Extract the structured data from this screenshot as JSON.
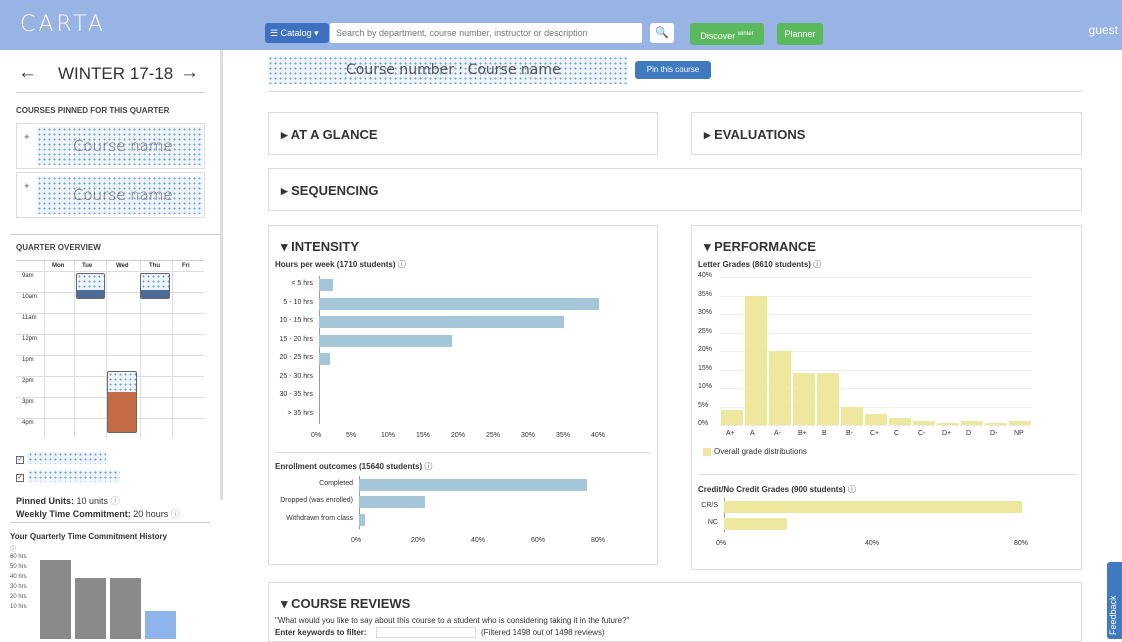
{
  "header": {
    "logo": "CARTA",
    "catalog_label": "☰ Catalog ▾",
    "search_placeholder": "Search by department, course number, instructor or description",
    "search_icon": "magnifier-icon",
    "discover_label": "Discover",
    "discover_sup": "winter",
    "planner_label": "Planner",
    "user": "guest"
  },
  "sidebar": {
    "quarter": "WINTER 17-18",
    "prev_arrow": "←",
    "next_arrow": "→",
    "pinned_title": "COURSES PINNED FOR THIS QUARTER",
    "pinned": [
      {
        "name": "Course name"
      },
      {
        "name": "Course name"
      }
    ],
    "overview_title": "QUARTER OVERVIEW",
    "days": [
      "Mon",
      "Tue",
      "Wed",
      "Thu",
      "Fri"
    ],
    "times": [
      "9am",
      "10am",
      "11am",
      "12pm",
      "1pm",
      "2pm",
      "3pm",
      "4pm"
    ],
    "pinned_units_label": "Pinned Units:",
    "pinned_units_value": "10 units",
    "weekly_label": "Weekly Time Commitment:",
    "weekly_value": "20 hours",
    "history_title": "Your Quarterly Time Commitment History",
    "history_axis": [
      "60 hrs",
      "50 hrs",
      "40 hrs",
      "30 hrs",
      "20 hrs",
      "10 hrs"
    ],
    "history_values": [
      57,
      44,
      44,
      20
    ],
    "history_colors": [
      "#8a8a8a",
      "#8a8a8a",
      "#8a8a8a",
      "#8fb4ec"
    ]
  },
  "course": {
    "banner": "Course number : Course name",
    "pin_button": "Pin this course"
  },
  "sections": {
    "glance": "▸ AT A GLANCE",
    "evaluations": "▸ EVALUATIONS",
    "sequencing": "▸ SEQUENCING",
    "intensity": "▾ INTENSITY",
    "performance": "▾ PERFORMANCE",
    "reviews": "▾ COURSE REVIEWS"
  },
  "reviews": {
    "question": "\"What would you like to say about this course to a student who is considering taking it in the future?\"",
    "filter_label": "Enter keywords to filter:",
    "filter_count": "(Filtered 1498 out of 1498 reviews)"
  },
  "feedback": "Feedback",
  "chart_data": [
    {
      "type": "bar",
      "orientation": "horizontal",
      "title": "Hours per week (1710 students)",
      "categories": [
        "< 5 hrs",
        "5 - 10 hrs",
        "10 - 15 hrs",
        "15 - 20 hrs",
        "20 - 25 hrs",
        "25 - 30 hrs",
        "30 - 35 hrs",
        "> 35 hrs"
      ],
      "values": [
        2,
        40,
        35,
        19,
        1.5,
        0,
        0,
        0
      ],
      "xticks": [
        "0%",
        "5%",
        "10%",
        "15%",
        "20%",
        "25%",
        "30%",
        "35%",
        "40%"
      ],
      "xlim": [
        0,
        40
      ]
    },
    {
      "type": "bar",
      "orientation": "horizontal",
      "title": "Enrollment outcomes (15640 students)",
      "categories": [
        "Completed",
        "Dropped (was enrolled)",
        "Withdrawn from class"
      ],
      "values": [
        76,
        22,
        2
      ],
      "xticks": [
        "0%",
        "20%",
        "40%",
        "60%",
        "80%"
      ],
      "xlim": [
        0,
        80
      ]
    },
    {
      "type": "bar",
      "title": "Letter Grades (8610 students)",
      "categories": [
        "A+",
        "A",
        "A-",
        "B+",
        "B",
        "B-",
        "C+",
        "C",
        "C-",
        "D+",
        "D",
        "D-",
        "NP"
      ],
      "values": [
        4,
        35,
        20,
        14,
        14,
        5,
        3,
        2,
        1,
        0.5,
        1,
        0.5,
        1
      ],
      "yticks": [
        "0%",
        "5%",
        "10%",
        "15%",
        "20%",
        "25%",
        "30%",
        "35%",
        "40%"
      ],
      "ylim": [
        0,
        40
      ],
      "legend": "Overall grade distributions"
    },
    {
      "type": "bar",
      "orientation": "horizontal",
      "title": "Credit/No Credit Grades (900 students)",
      "categories": [
        "CR/S",
        "NC"
      ],
      "values": [
        83,
        17
      ],
      "xticks": [
        "0%",
        "40%",
        "80%"
      ],
      "xlim": [
        0,
        80
      ]
    }
  ]
}
